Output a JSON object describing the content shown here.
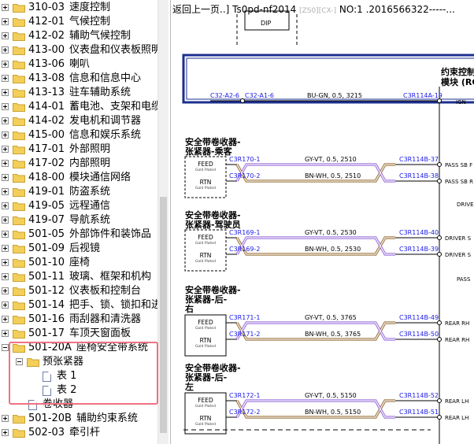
{
  "tree": {
    "items": [
      {
        "code": "310-03",
        "label": "速度控制",
        "expand": "plus"
      },
      {
        "code": "412-01",
        "label": "气候控制",
        "expand": "plus"
      },
      {
        "code": "412-02",
        "label": "辅助气候控制",
        "expand": "plus"
      },
      {
        "code": "413-00",
        "label": "仪表盘和仪表板照明",
        "expand": "plus"
      },
      {
        "code": "413-06",
        "label": "喇叭",
        "expand": "plus"
      },
      {
        "code": "413-08",
        "label": "信息和信息中心",
        "expand": "plus"
      },
      {
        "code": "413-13",
        "label": "驻车辅助系统",
        "expand": "plus"
      },
      {
        "code": "414-01",
        "label": "蓄电池、支架和电缆",
        "expand": "plus"
      },
      {
        "code": "414-02",
        "label": "发电机和调节器",
        "expand": "plus"
      },
      {
        "code": "415-00",
        "label": "信息和娱乐系统",
        "expand": "plus"
      },
      {
        "code": "417-01",
        "label": "外部照明",
        "expand": "plus"
      },
      {
        "code": "417-02",
        "label": "内部照明",
        "expand": "plus"
      },
      {
        "code": "418-00",
        "label": "模块通信网络",
        "expand": "plus"
      },
      {
        "code": "419-01",
        "label": "防盗系统",
        "expand": "plus"
      },
      {
        "code": "419-05",
        "label": "远程通信",
        "expand": "plus"
      },
      {
        "code": "419-07",
        "label": "导航系统",
        "expand": "plus"
      },
      {
        "code": "501-05",
        "label": "外部饰件和装饰品",
        "expand": "plus"
      },
      {
        "code": "501-09",
        "label": "后视镜",
        "expand": "plus"
      },
      {
        "code": "501-10",
        "label": "座椅",
        "expand": "plus"
      },
      {
        "code": "501-11",
        "label": "玻璃、框架和机构",
        "expand": "plus"
      },
      {
        "code": "501-12",
        "label": "仪表板和控制台",
        "expand": "plus"
      },
      {
        "code": "501-14",
        "label": "把手、锁、锁扣和进入系统",
        "expand": "plus"
      },
      {
        "code": "501-16",
        "label": "雨刮器和清洗器",
        "expand": "plus"
      },
      {
        "code": "501-17",
        "label": "车顶天窗面板",
        "expand": "plus"
      },
      {
        "code": "501-20A",
        "label": "座椅安全带系统",
        "expand": "minus"
      },
      {
        "code": "",
        "label": "预张紧器",
        "expand": "minus",
        "indent": 1
      },
      {
        "code": "",
        "label": "表 1",
        "doc": true,
        "indent": 2
      },
      {
        "code": "",
        "label": "表 2",
        "doc": true,
        "indent": 2
      },
      {
        "code": "",
        "label": "卷收器",
        "doc": true,
        "indent": 1
      },
      {
        "code": "501-20B",
        "label": "辅助约束系统",
        "expand": "plus"
      },
      {
        "code": "502-03",
        "label": "牵引杆",
        "expand": "plus"
      }
    ]
  },
  "colors": {
    "folder": "#f3cf5a",
    "folder_edge": "#c9a231",
    "highlight": "#f07183",
    "link": "#1a1ae6",
    "module_border": "#1c2f8f",
    "wire_purple": "#8a57d4",
    "wire_brown": "#8a5a1a"
  },
  "doc": {
    "header_left": "返回上一页..] Ts0pd-nf2014",
    "header_grey": "[ZS0][CX-]",
    "header_right": "NO:1 .2016566322-----...",
    "dip": "DIP",
    "module_title_line1": "约束控制",
    "module_title_line2": "模块 (RC",
    "ign": {
      "left": "C32-A2-6",
      "mid": "C32-A1-6",
      "wire": "BU-GN, 0.5, 3215",
      "right": "C3R114A-19",
      "pin": "IGN"
    },
    "groups": [
      {
        "title1": "安全带卷收器-",
        "title2": "张紧器-乘客",
        "feed": "FEED",
        "rtn": "RTN",
        "gold": "Gold Plated",
        "dashed": true,
        "w1": {
          "left": "C3R170-1",
          "wire": "GY-VT, 0.5, 2510",
          "right": "C3R114B-37",
          "pin": "PASS SB F"
        },
        "w2": {
          "left": "C3R170-2",
          "wire": "BN-WH, 0.5, 2510",
          "right": "C3R114B-38",
          "pin": "PASS SB R"
        },
        "side": ""
      },
      {
        "title1": "安全带卷收器-",
        "title2": "张紧器-驾驶员",
        "feed": "FEED",
        "rtn": "RTN",
        "gold": "Gold Plated",
        "dashed": true,
        "w1": {
          "left": "C3R169-1",
          "wire": "GY-VT, 0.5, 2530",
          "right": "C3R114B-40",
          "pin": "DRIVER S"
        },
        "w2": {
          "left": "C3R169-2",
          "wire": "BN-WH, 0.5, 2530",
          "right": "C3R114B-39",
          "pin": "DRIVER S"
        },
        "side": "DRIVE"
      },
      {
        "title1": "安全带卷收器-",
        "title2": "张紧器-后-",
        "title3": "右",
        "feed": "FEED",
        "rtn": "RTN",
        "gold": "Gold Plated",
        "dashed": false,
        "w1": {
          "left": "C3R171-1",
          "wire": "GY-VT, 0.5, 3765",
          "right": "C3R114B-49",
          "pin": "REAR RH"
        },
        "w2": {
          "left": "C3R171-2",
          "wire": "BN-WH, 0.5, 3765",
          "right": "C3R114B-50",
          "pin": "REAR RH"
        },
        "side": "PASS"
      },
      {
        "title1": "安全带卷收器-",
        "title2": "张紧器-后-",
        "title3": "左",
        "feed": "FEED",
        "rtn": "RTN",
        "gold": "Gold Plated",
        "dashed": false,
        "w1": {
          "left": "C3R172-1",
          "wire": "GY-VT, 0.5, 5150",
          "right": "C3R114B-52",
          "pin": "REAR LH"
        },
        "w2": {
          "left": "C3R172-2",
          "wire": "BN-WH, 0.5, 5150",
          "right": "C3R114B-51",
          "pin": "REAR LH"
        },
        "side": ""
      }
    ]
  }
}
